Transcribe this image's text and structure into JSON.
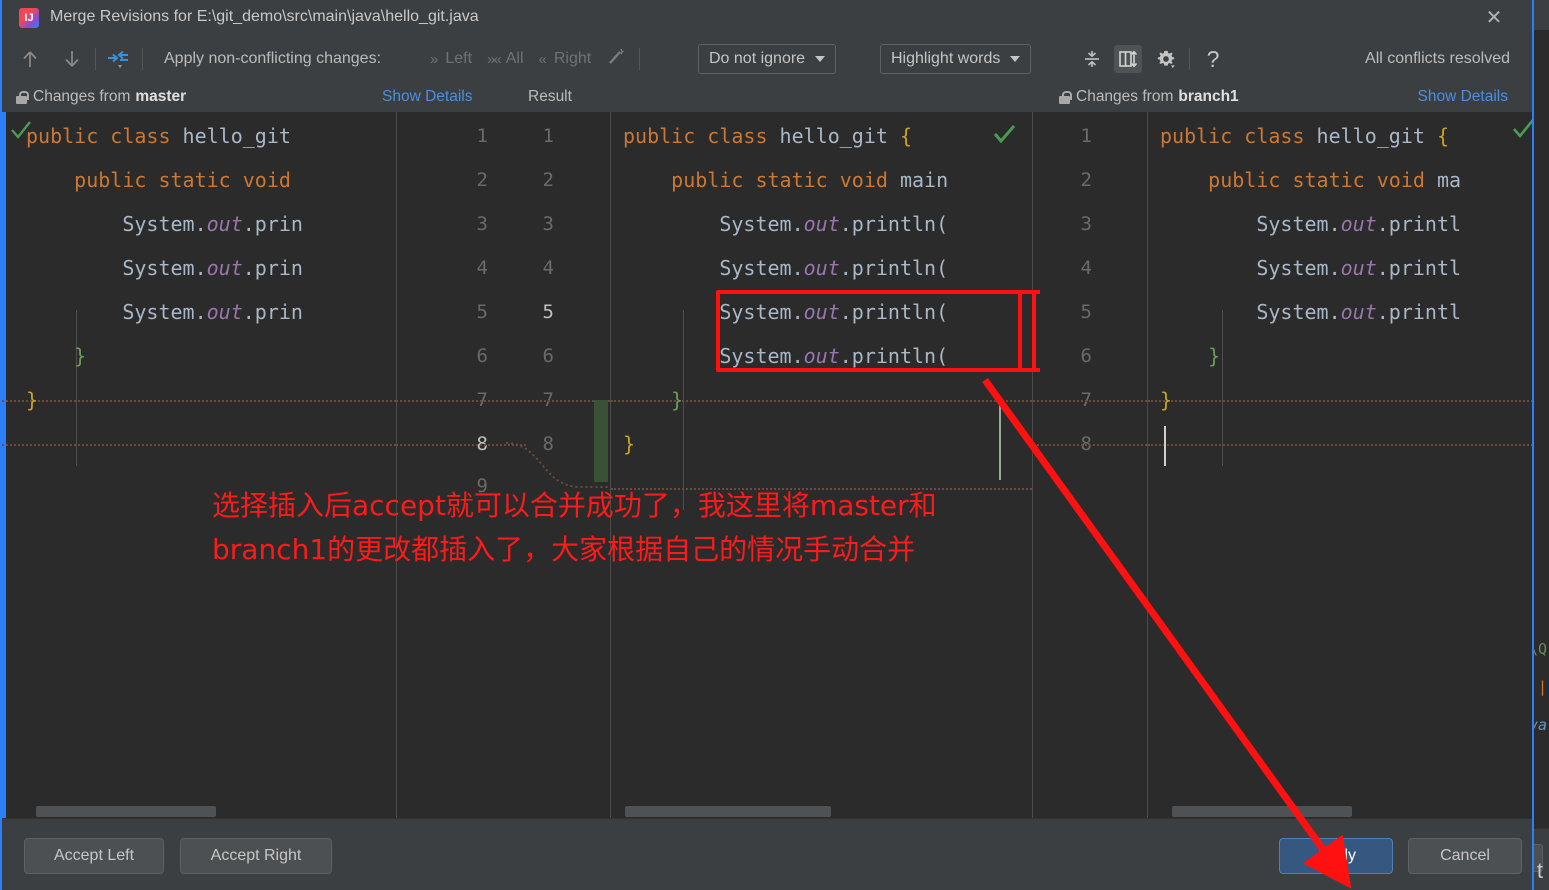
{
  "window": {
    "title": "Merge Revisions for E:\\git_demo\\src\\main\\java\\hello_git.java",
    "app_icon": "intellij-idea-icon",
    "close_icon": "close-icon"
  },
  "toolbar": {
    "prev_difference_icon": "arrow-up-icon",
    "next_difference_icon": "arrow-down-icon",
    "apply_all_icon": "merge-arrows-icon",
    "apply_label": "Apply non-conflicting changes:",
    "apply_left_label": "Left",
    "apply_all_label": "All",
    "apply_right_label": "Right",
    "magic_resolve_icon": "magic-wand-icon",
    "ignore_policy": {
      "value": "Do not ignore",
      "caret_icon": "chevron-down-icon"
    },
    "highlight_policy": {
      "value": "Highlight words",
      "caret_icon": "chevron-down-icon"
    },
    "collapse_unchanged_icon": "collapse-lines-icon",
    "synchronize_scroll_icon": "two-columns-sync-icon",
    "settings_icon": "gear-icon",
    "help_icon": "question-mark-icon",
    "status": "All conflicts resolved"
  },
  "panes": {
    "left": {
      "header_prefix": "Changes from",
      "header_name": "master",
      "lock_icon": "lock-icon",
      "show_details": "Show Details",
      "accept_check_icon": "green-check-icon",
      "lines": [
        "public class hello_git ",
        "    public static void ",
        "        System.out.prin",
        "        System.out.prin",
        "        System.out.prin",
        "    }",
        "}"
      ]
    },
    "result": {
      "header": "Result",
      "lines": [
        "public class hello_git {",
        "    public static void main",
        "        System.out.println(",
        "        System.out.println(",
        "        System.out.println(",
        "        System.out.println(",
        "    }",
        "}"
      ],
      "line_numbers_left": [
        "1",
        "2",
        "3",
        "4",
        "5",
        "6",
        "7",
        "8",
        "9"
      ],
      "line_numbers_right": [
        "1",
        "2",
        "3",
        "4",
        "5",
        "6",
        "7",
        "8"
      ],
      "accept_check_icon": "green-check-icon"
    },
    "right": {
      "header_prefix": "Changes from",
      "header_name": "branch1",
      "lock_icon": "lock-icon",
      "show_details": "Show Details",
      "accept_check_icon": "green-check-icon",
      "line_numbers": [
        "1",
        "2",
        "3",
        "4",
        "5",
        "6",
        "7",
        "8"
      ],
      "lines": [
        "public class hello_git {",
        "    public static void ma",
        "        System.out.printl",
        "        System.out.printl",
        "        System.out.printl",
        "    }",
        "}",
        ""
      ]
    }
  },
  "annotation": {
    "line1": "选择插入后accept就可以合并成功了，我这里将master和",
    "line2": "branch1的更改都插入了，大家根据自己的情况手动合并",
    "color": "#ff1a1a",
    "highlight_box_color": "#ff1111",
    "arrow_color": "#ff1111"
  },
  "footer": {
    "accept_left": "Accept Left",
    "accept_right": "Accept Right",
    "apply": "Apply",
    "cancel": "Cancel"
  },
  "colors": {
    "accent": "#2d7ff9",
    "panel_bg": "#3c3f41",
    "editor_bg": "#2b2b2b",
    "keyword": "#cc7832",
    "field": "#9876aa",
    "text": "#a9b7c6",
    "link": "#4a8fe0",
    "inserted_block": "#3a5138",
    "primary_button": "#365880"
  },
  "background_ide": {
    "snippet1": "\\Q",
    "snippet2": "va",
    "snippet3": "t"
  }
}
